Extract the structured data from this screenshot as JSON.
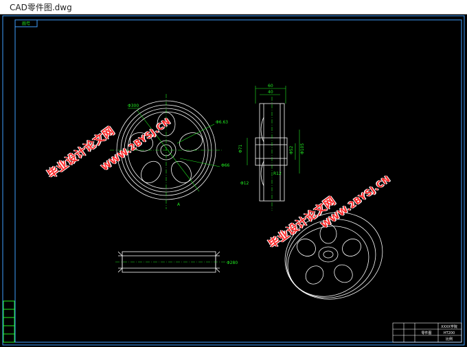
{
  "window": {
    "title": "CAD零件图.dwg"
  },
  "colors": {
    "background": "#000000",
    "lines": "#ffffff",
    "dimensions": "#22ee22",
    "watermark": "#ff2a2a",
    "frame": "#3fa0ff"
  },
  "drawing": {
    "frame_tag": "图号",
    "front_view": {
      "dim_outer": "Φ300",
      "dim_hub": "Φ6.63",
      "dim_inner": "Φ66",
      "section_mark": "A"
    },
    "side_view": {
      "dim_width_outer": "60",
      "dim_width_inner": "40",
      "dim_bore_left": "Φ71",
      "dim_bore_right": "Φ52",
      "dim_bore_big": "Φ105",
      "dim_chamfer": "Φ12",
      "dim_r": "R12"
    },
    "bottom_view": {
      "dim_label": "Φ280"
    }
  },
  "watermarks": [
    {
      "text": "毕业设计论文网"
    },
    {
      "text": "WWW.2BYSJ.CN"
    },
    {
      "text": "毕业设计论文网"
    },
    {
      "text": "WWW.2BYSJ.CN"
    }
  ],
  "title_block": {
    "company": "XXXX学院",
    "part_name": "零件图",
    "material": "HT200",
    "scale": "比例"
  }
}
